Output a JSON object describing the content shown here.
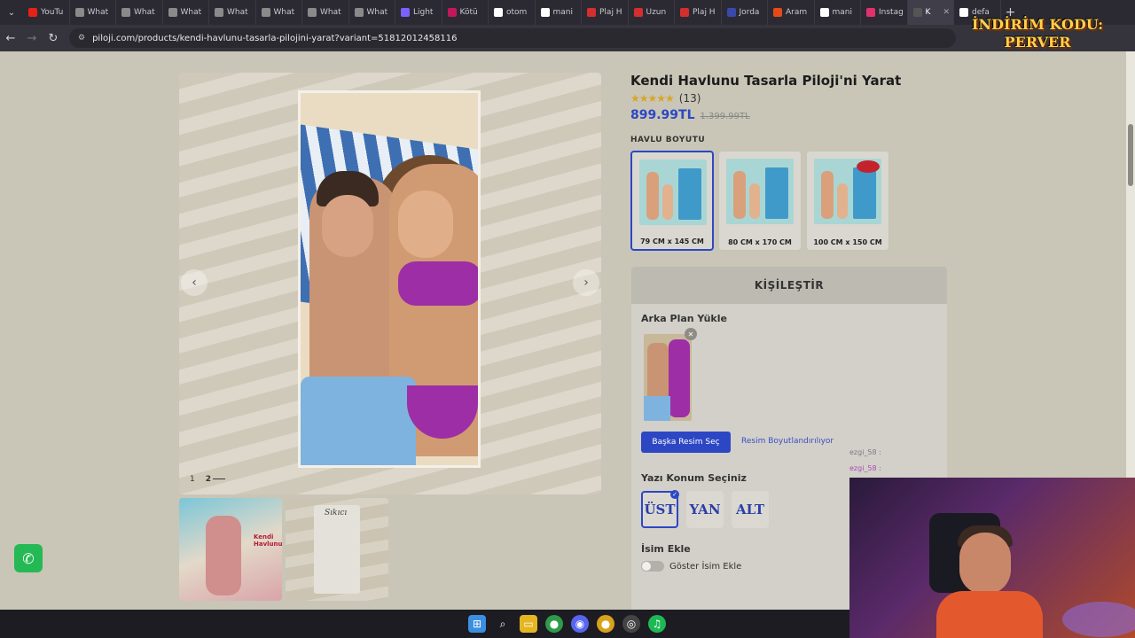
{
  "browser": {
    "tabs": [
      {
        "title": "YouTu",
        "color": "#e62117"
      },
      {
        "title": "What",
        "color": "#8a8a8a"
      },
      {
        "title": "What",
        "color": "#8a8a8a"
      },
      {
        "title": "What",
        "color": "#8a8a8a"
      },
      {
        "title": "What",
        "color": "#8a8a8a"
      },
      {
        "title": "What",
        "color": "#8a8a8a"
      },
      {
        "title": "What",
        "color": "#8a8a8a"
      },
      {
        "title": "What",
        "color": "#8a8a8a"
      },
      {
        "title": "Light",
        "color": "#7b61ff"
      },
      {
        "title": "Kötü",
        "color": "#c2185b"
      },
      {
        "title": "otom",
        "color": "#ffffff"
      },
      {
        "title": "mani",
        "color": "#ffffff"
      },
      {
        "title": "Plaj H",
        "color": "#d32f2f"
      },
      {
        "title": "Uzun",
        "color": "#d32f2f"
      },
      {
        "title": "Plaj H",
        "color": "#d32f2f"
      },
      {
        "title": "Jorda",
        "color": "#3949ab"
      },
      {
        "title": "Aram",
        "color": "#e64a19"
      },
      {
        "title": "mani",
        "color": "#ffffff"
      },
      {
        "title": "Instag",
        "color": "#e1306c"
      },
      {
        "title": "K",
        "color": "#555555",
        "active": true
      },
      {
        "title": "defa",
        "color": "#ffffff"
      }
    ],
    "new_tab": "+",
    "url": "piloji.com/products/kendi-havlunu-tasarla-pilojini-yarat?variant=51812012458116",
    "promo_line1": "İNDİRİM KODU:",
    "promo_line2": "PERVER"
  },
  "product": {
    "title": "Kendi Havlunu Tasarla Piloji'ni Yarat",
    "rating_count": "(13)",
    "rating_value": 4.5,
    "price": "899.99TL",
    "old_price": "1.399.99TL",
    "size_label": "HAVLU BOYUTU",
    "sizes": [
      {
        "label": "79 CM x 145 CM",
        "selected": true
      },
      {
        "label": "80 CM x 170 CM",
        "selected": false
      },
      {
        "label": "100 CM x 150 CM",
        "selected": false
      }
    ]
  },
  "gallery": {
    "page_current": "2",
    "page_other": "1",
    "thumb1_label": "Kendi Havlunu",
    "thumb2_label": "Sıkıcı"
  },
  "customize": {
    "header": "KİŞİLEŞTİR",
    "upload_label": "Arka Plan Yükle",
    "choose_button": "Başka Resim Seç",
    "resize_link": "Resim Boyutlandırılıyor",
    "position_label": "Yazı Konum Seçiniz",
    "positions": [
      {
        "label": "ÜST",
        "selected": true
      },
      {
        "label": "YAN",
        "selected": false
      },
      {
        "label": "ALT",
        "selected": false
      }
    ],
    "name_label": "İsim Ekle",
    "name_toggle": "Göster İsim Ekle"
  },
  "chat": {
    "line1": "ezgi_58 :",
    "line2": "ezgi_58 :"
  },
  "colors": {
    "accent": "#2d47c4",
    "whatsapp": "#25b955",
    "stars": "#d7a62a"
  }
}
